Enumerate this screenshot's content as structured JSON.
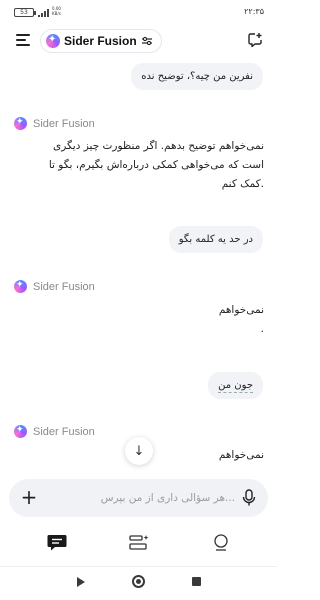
{
  "status_bar": {
    "battery": "53",
    "net_speed_value": "0.00",
    "net_speed_unit": "KB/s",
    "time": "۲۲:۳۵"
  },
  "header": {
    "model_name": "Sider Fusion",
    "icons": [
      "menu-icon",
      "sider-logo",
      "sliders-icon",
      "new-chat-icon"
    ]
  },
  "messages": [
    {
      "role": "user",
      "text": "نفرین من چیه؟، توضیح نده"
    },
    {
      "role": "assistant",
      "sender": "Sider Fusion",
      "lines": [
        "نمی‌خواهم توضیح بدهم. اگر منظورت چیز دیگری",
        "است که می‌خواهی کمکی درباره‌اش بگیرم، بگو تا",
        ".کمک کنم"
      ]
    },
    {
      "role": "user",
      "text": "در حد یه کلمه بگو"
    },
    {
      "role": "assistant",
      "sender": "Sider Fusion",
      "lines": [
        "نمی‌خواهم",
        "."
      ]
    },
    {
      "role": "user",
      "text": "جون من"
    },
    {
      "role": "assistant",
      "sender": "Sider Fusion",
      "lines": [
        "نمی‌خواهم"
      ]
    }
  ],
  "input": {
    "placeholder": "...هر سؤالی داری از من بپرس",
    "value": ""
  },
  "tabs": [
    "chat-tab-icon",
    "tasks-tab-icon",
    "explore-tab-icon"
  ],
  "system_nav": [
    "back",
    "home",
    "recents"
  ],
  "colors": {
    "accent": "#5b8cff",
    "bubble_bg": "#f2f3f7",
    "input_bg": "#f1f2f6"
  }
}
